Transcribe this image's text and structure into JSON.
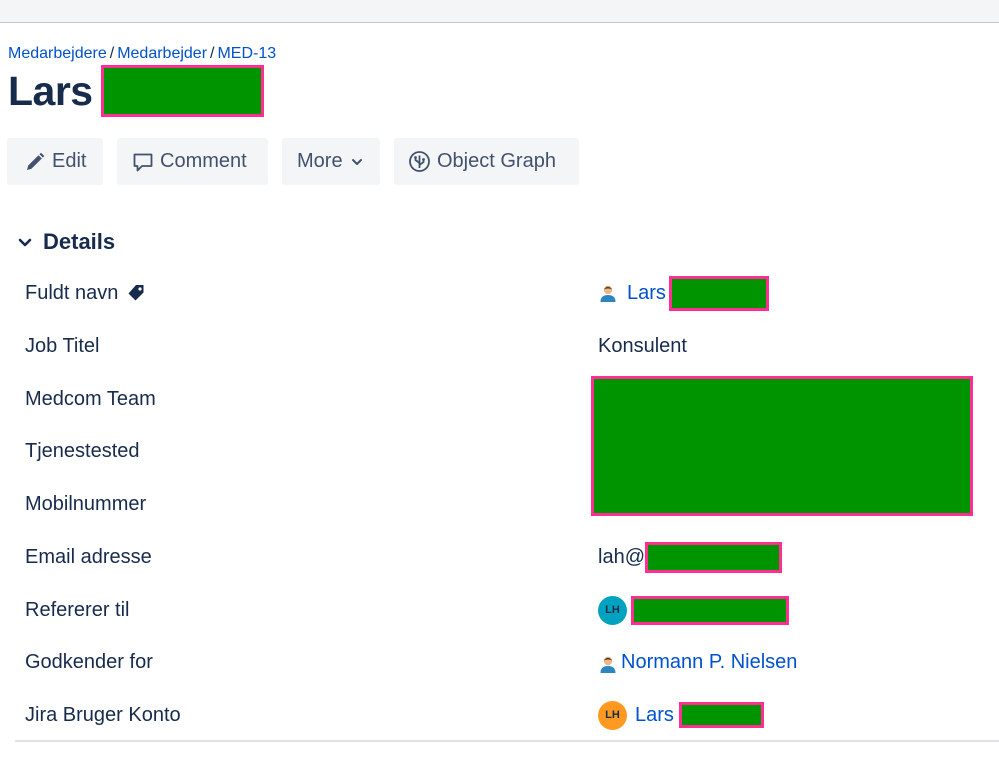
{
  "breadcrumb": {
    "items": [
      "Medarbejdere",
      "Medarbejder",
      "MED-13"
    ],
    "separator": "/"
  },
  "page": {
    "title": "Lars"
  },
  "toolbar": {
    "edit_label": "Edit",
    "comment_label": "Comment",
    "more_label": "More",
    "graph_label": "Object Graph"
  },
  "section": {
    "title": "Details"
  },
  "details": {
    "full_name_label": "Fuldt navn",
    "full_name_value": "Lars",
    "job_title_label": "Job Titel",
    "job_title_value": "Konsulent",
    "team_label": "Medcom Team",
    "location_label": "Tjenestested",
    "mobile_label": "Mobilnummer",
    "email_label": "Email adresse",
    "email_prefix": "lah@",
    "refers_label": "Refererer til",
    "refers_avatar": "LH",
    "approver_label": "Godkender for",
    "approver_value": "Normann P. Nielsen",
    "jira_label": "Jira Bruger Konto",
    "jira_avatar": "LH",
    "jira_value": "Lars"
  },
  "icons": {
    "edit": "pencil-icon",
    "comment": "speech-bubble-icon",
    "more": "chevron-down-icon",
    "graph": "object-graph-icon",
    "section": "chevron-down-icon",
    "label_tag": "tag-icon",
    "user": "user-icon"
  },
  "colors": {
    "link": "#0052cc",
    "text": "#172b4d",
    "button_bg": "#f4f5f7",
    "redaction_fill": "#009400",
    "redaction_border": "#ff2e92",
    "avatar_teal": "#00a3bf",
    "avatar_orange": "#ff991f"
  }
}
